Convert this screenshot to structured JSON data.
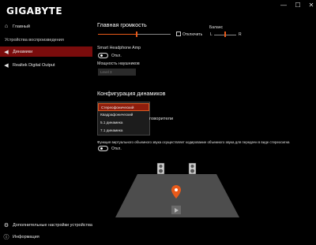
{
  "app": {
    "brand": "GIGABYTE",
    "minimize": "—",
    "maximize": "☐",
    "close": "✕"
  },
  "sidebar": {
    "home": "Главный",
    "section_title": "Устройства воспроизведения",
    "items": [
      {
        "label": "Динамики",
        "icon": "speaker-icon",
        "active": true
      },
      {
        "label": "Realtek Digital Output",
        "icon": "speaker-icon",
        "active": false
      }
    ],
    "advanced": "Дополнительные настройки устройства",
    "info": "Информация"
  },
  "main": {
    "volume_title": "Главная громкость",
    "volume_level": 0.44,
    "mute_label": "Отключить",
    "balance_label": "Баланс",
    "balance_left": "L",
    "balance_right": "R",
    "smart_amp_label": "Smart Headphone Amp",
    "smart_amp_state": "Откл.",
    "headphone_power_label": "Мощность наушников",
    "headphone_power_value": "Level 3",
    "config_title": "Конфигурация динамиков",
    "dropdown_options": [
      "Стереофонический",
      "Квадрафонический",
      "5.1 динамика",
      "7.1 динамика"
    ],
    "dropdown_selected_index": 0,
    "partial_text": "говорители",
    "virtual_surround_desc": "Функция виртуального объемного звука осуществляет кодирование объемного звука для передачи в виде стереосигна",
    "virtual_surround_state": "Откл."
  },
  "colors": {
    "accent": "#e85a1a",
    "active_bg": "#7a0c0c",
    "background": "#000000"
  }
}
